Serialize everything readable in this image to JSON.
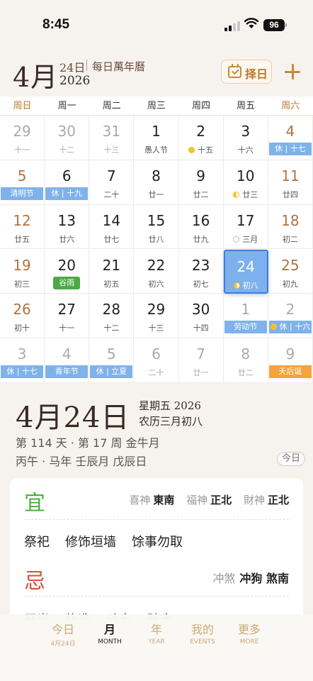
{
  "status": {
    "time": "8:45",
    "battery": "96"
  },
  "header": {
    "month": "4月",
    "day": "24日",
    "app_name": "每日萬年曆",
    "year": "2026",
    "pick_day_label": "择日"
  },
  "weekdays": [
    "周日",
    "周一",
    "周二",
    "周三",
    "周四",
    "周五",
    "周六"
  ],
  "calendar": {
    "rows": [
      [
        {
          "n": "29",
          "s": "十一",
          "other": true
        },
        {
          "n": "30",
          "s": "十二",
          "other": true
        },
        {
          "n": "31",
          "s": "十三",
          "other": true
        },
        {
          "n": "1",
          "s": "愚人节"
        },
        {
          "n": "2",
          "s": "十五",
          "moon": "full"
        },
        {
          "n": "3",
          "s": "十六"
        },
        {
          "n": "4",
          "s": "休 | 十七",
          "tag": "blue"
        }
      ],
      [
        {
          "n": "5",
          "s": "清明节",
          "tag": "blue"
        },
        {
          "n": "6",
          "s": "休 | 十九",
          "tag": "blue"
        },
        {
          "n": "7",
          "s": "二十"
        },
        {
          "n": "8",
          "s": "廿一"
        },
        {
          "n": "9",
          "s": "廿二"
        },
        {
          "n": "10",
          "s": "廿三",
          "moon": "half"
        },
        {
          "n": "11",
          "s": "廿四"
        }
      ],
      [
        {
          "n": "12",
          "s": "廿五"
        },
        {
          "n": "13",
          "s": "廿六"
        },
        {
          "n": "14",
          "s": "廿七"
        },
        {
          "n": "15",
          "s": "廿八"
        },
        {
          "n": "16",
          "s": "廿九"
        },
        {
          "n": "17",
          "s": "三月",
          "moon": "new"
        },
        {
          "n": "18",
          "s": "初二"
        }
      ],
      [
        {
          "n": "19",
          "s": "初三"
        },
        {
          "n": "20",
          "s": "谷雨",
          "tag": "green"
        },
        {
          "n": "21",
          "s": "初五"
        },
        {
          "n": "22",
          "s": "初六"
        },
        {
          "n": "23",
          "s": "初七"
        },
        {
          "n": "24",
          "s": "初八",
          "moon": "half",
          "selected": true
        },
        {
          "n": "25",
          "s": "初九"
        }
      ],
      [
        {
          "n": "26",
          "s": "初十"
        },
        {
          "n": "27",
          "s": "十一"
        },
        {
          "n": "28",
          "s": "十二"
        },
        {
          "n": "29",
          "s": "十三"
        },
        {
          "n": "30",
          "s": "十四"
        },
        {
          "n": "1",
          "s": "劳动节",
          "tag": "blue",
          "other": true
        },
        {
          "n": "2",
          "s": "休 | 十六",
          "tag": "blue",
          "moon": "full",
          "other": true
        }
      ],
      [
        {
          "n": "3",
          "s": "休 | 十七",
          "tag": "blue",
          "other": true
        },
        {
          "n": "4",
          "s": "青年节",
          "tag": "blue",
          "other": true
        },
        {
          "n": "5",
          "s": "休 | 立夏",
          "tag": "blue",
          "other": true
        },
        {
          "n": "6",
          "s": "二十",
          "other": true
        },
        {
          "n": "7",
          "s": "廿一",
          "other": true
        },
        {
          "n": "8",
          "s": "廿二",
          "other": true
        },
        {
          "n": "9",
          "s": "天后诞",
          "tag": "orange",
          "other": true
        }
      ]
    ]
  },
  "detail": {
    "date": "4月24日",
    "weekday_year": "星期五 2026",
    "lunar": "农历三月初八",
    "info": "第 114 天 · 第 17 周 金牛月",
    "ganzhi": "丙午 · 马年 壬辰月 戊辰日",
    "today_button": "今日"
  },
  "yiji": {
    "yi_label": "宜",
    "ji_label": "忌",
    "gods": [
      {
        "k": "喜神",
        "v": "東南"
      },
      {
        "k": "福神",
        "v": "正北"
      },
      {
        "k": "財神",
        "v": "正北"
      }
    ],
    "yi_items": [
      "祭祀",
      "修饰垣墙",
      "馀事勿取"
    ],
    "chong_label": "冲煞",
    "chong_value": "冲狗 煞南",
    "ji_items": [
      "开光",
      "修造",
      "动土",
      "破土"
    ]
  },
  "tabs": [
    {
      "t1": "今日",
      "t2": "4月24日"
    },
    {
      "t1": "月",
      "t2": "MONTH",
      "active": true
    },
    {
      "t1": "年",
      "t2": "YEAR"
    },
    {
      "t1": "我的",
      "t2": "EVENTS"
    },
    {
      "t1": "更多",
      "t2": "MORE"
    }
  ]
}
